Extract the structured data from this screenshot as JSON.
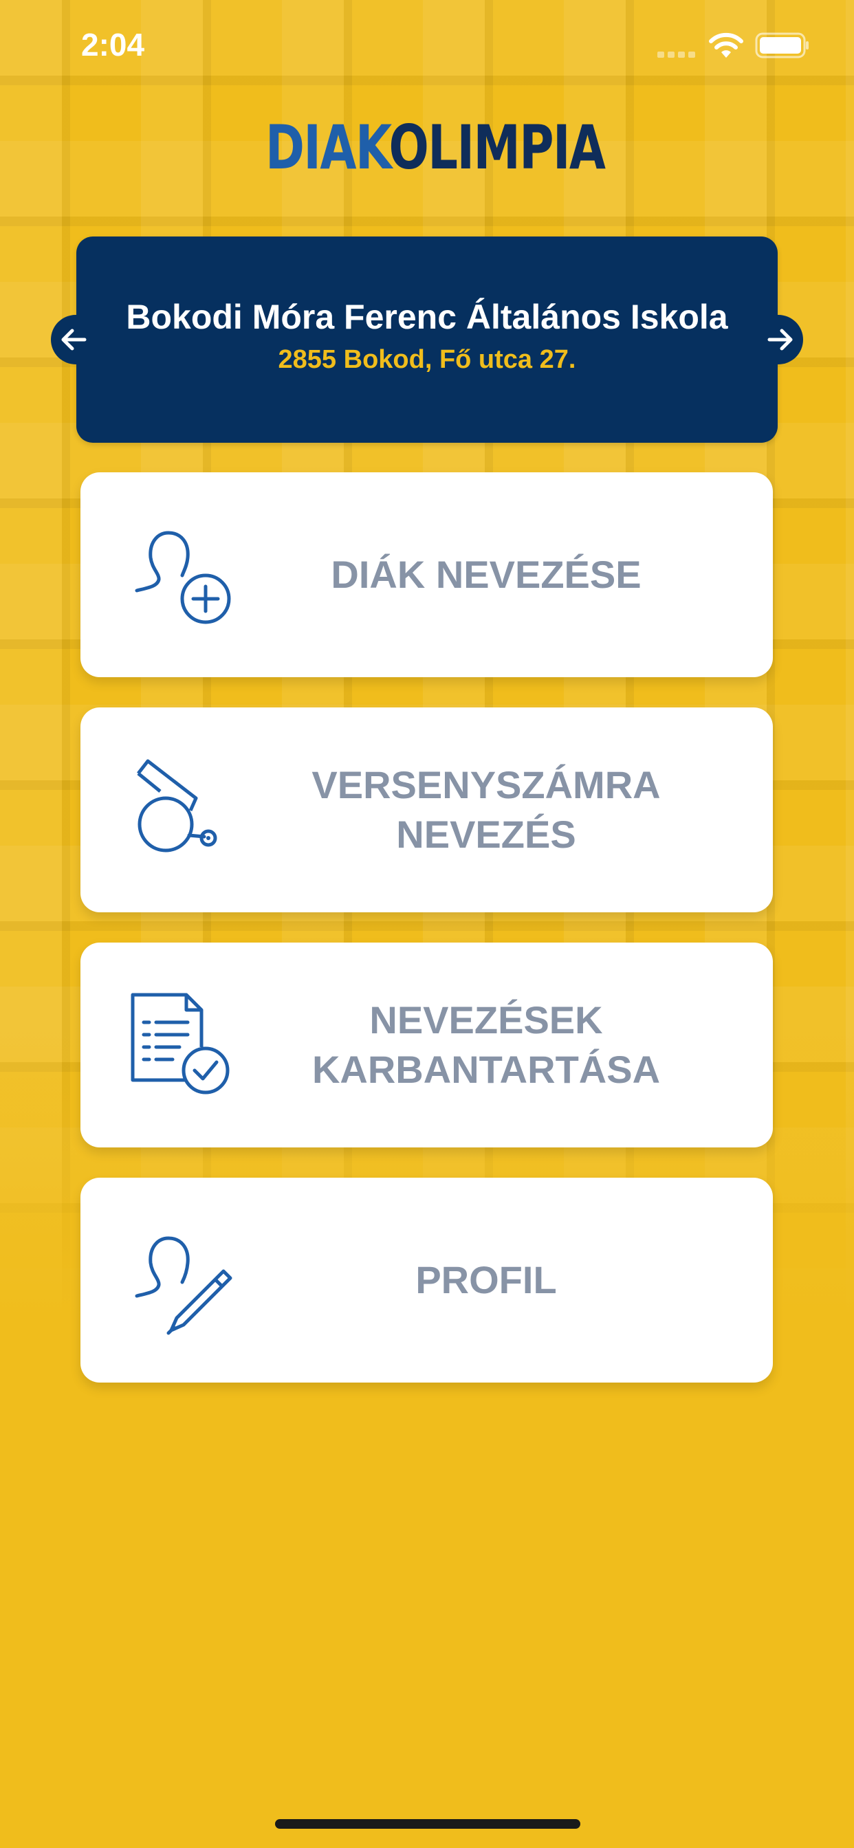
{
  "status_bar": {
    "time": "2:04"
  },
  "logo": {
    "part1": "DIAK",
    "part2": "OLIMPIA"
  },
  "school": {
    "name": "Bokodi Móra Ferenc Általános Iskola",
    "address": "2855 Bokod, Fő utca 27."
  },
  "menu": [
    {
      "label": "DIÁK NEVEZÉSE",
      "icon": "add-user-icon"
    },
    {
      "label": "VERSENYSZÁMRA\nNEVEZÉS",
      "icon": "whistle-icon"
    },
    {
      "label": "NEVEZÉSEK\nKARBANTARTÁSA",
      "icon": "checklist-document-icon"
    },
    {
      "label": "PROFIL",
      "icon": "edit-profile-icon"
    }
  ],
  "colors": {
    "background": "#f0bd1c",
    "card_dark": "#06305f",
    "accent_yellow": "#f0bd1c",
    "icon_blue": "#1f5faa",
    "menu_text": "#8793a6"
  }
}
